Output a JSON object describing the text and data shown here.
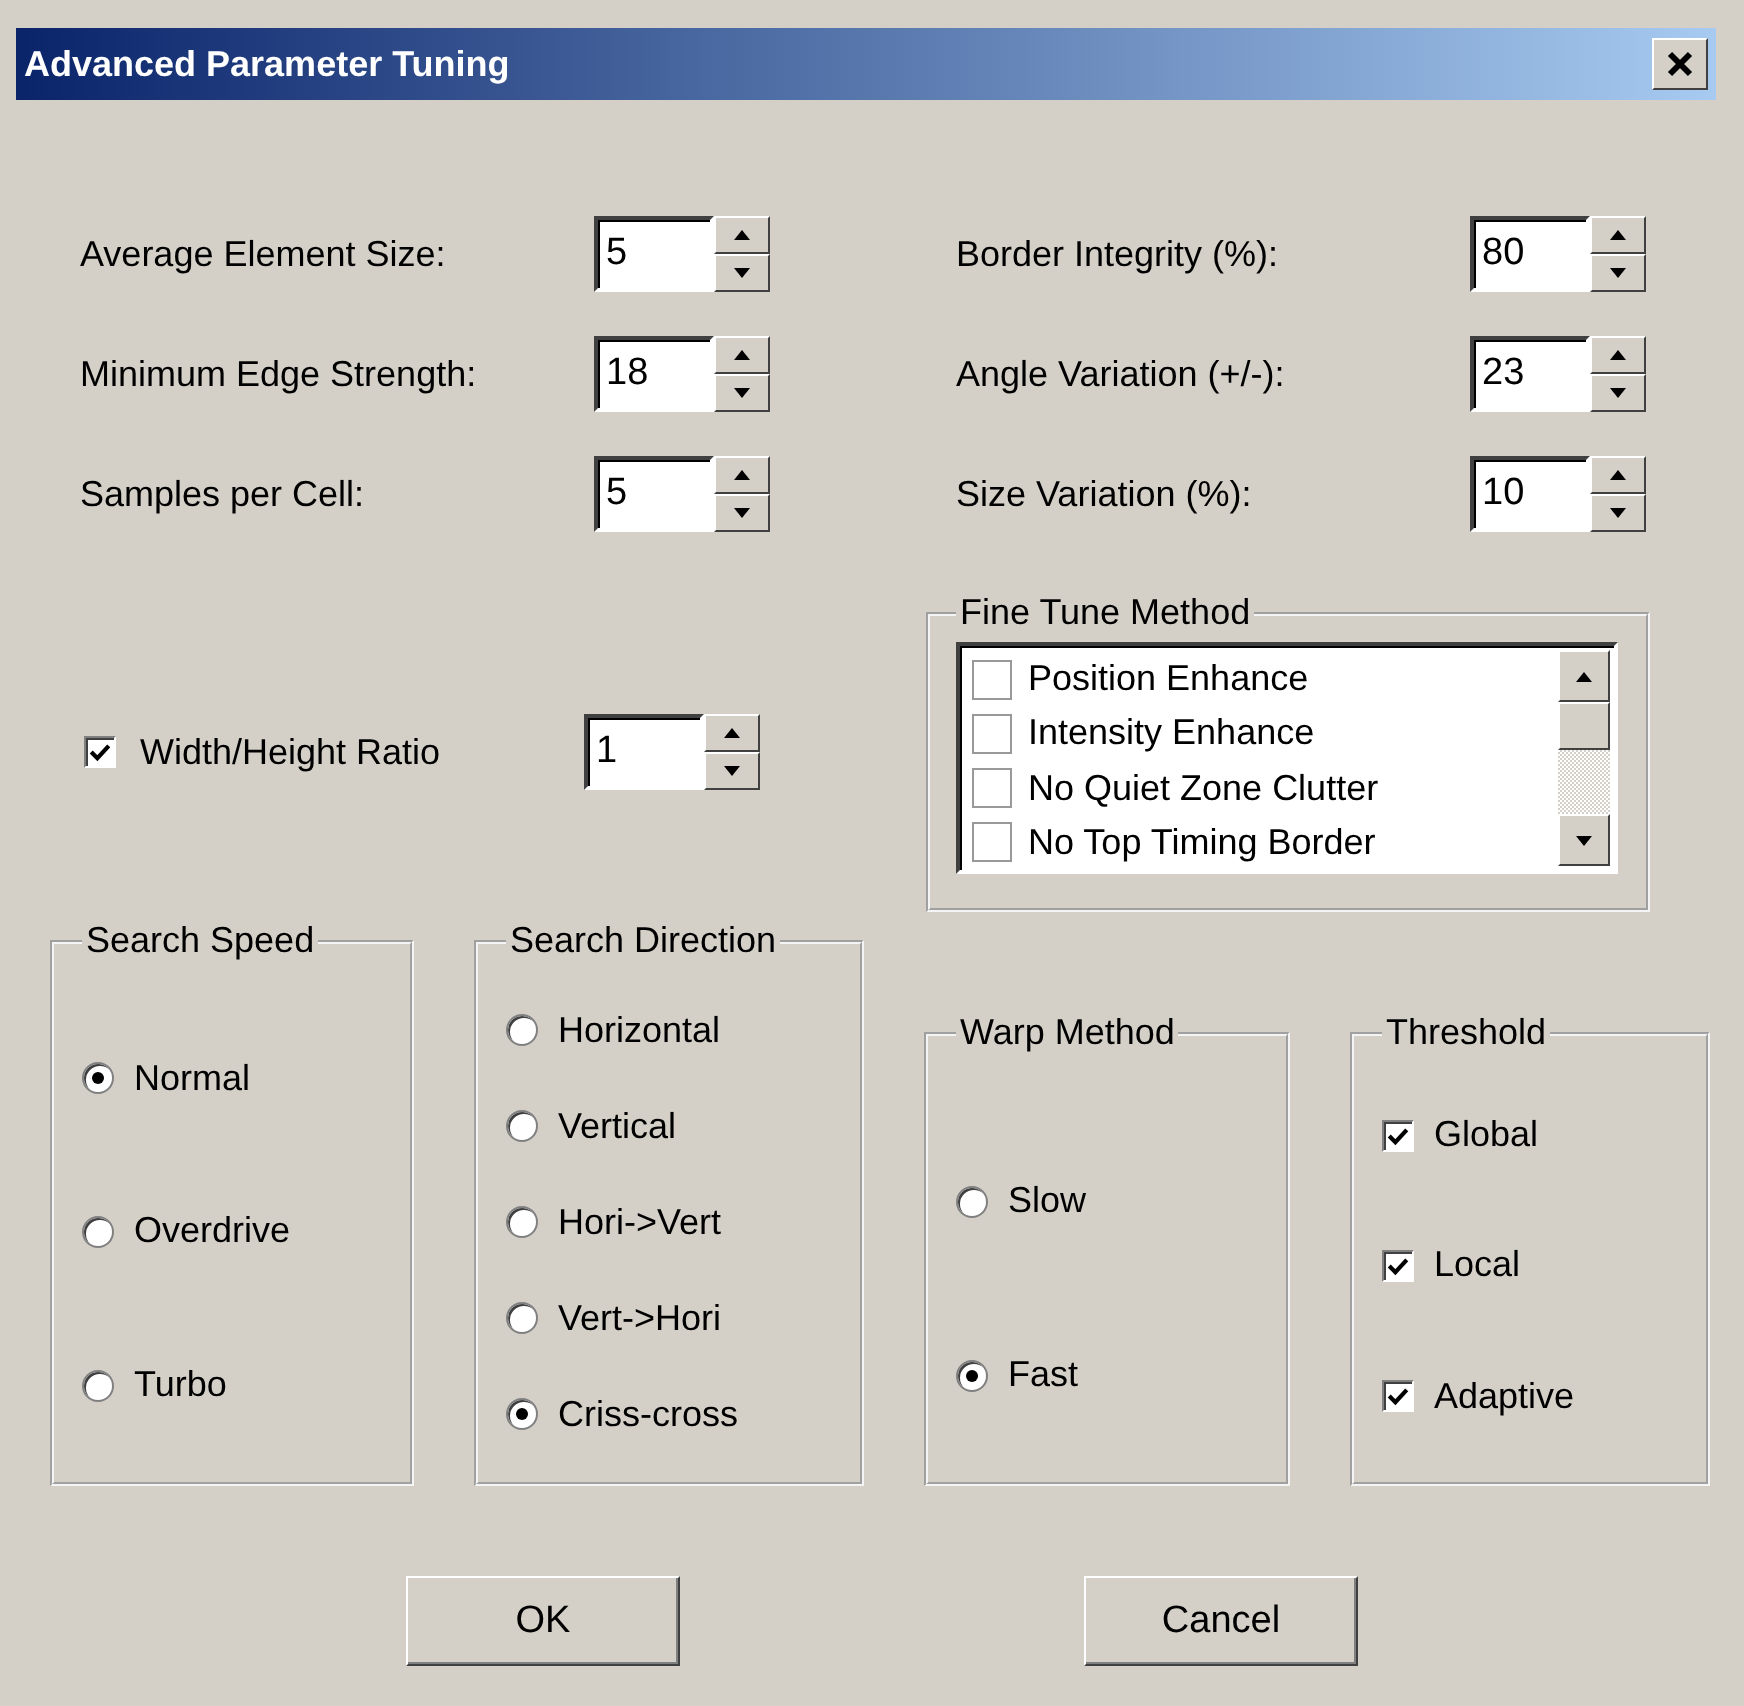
{
  "window": {
    "title": "Advanced Parameter Tuning"
  },
  "left_params": [
    {
      "label": "Average Element Size:",
      "value": "5"
    },
    {
      "label": "Minimum Edge Strength:",
      "value": "18"
    },
    {
      "label": "Samples per Cell:",
      "value": "5"
    }
  ],
  "right_params": [
    {
      "label": "Border Integrity (%):",
      "value": "80"
    },
    {
      "label": "Angle Variation (+/-):",
      "value": "23"
    },
    {
      "label": "Size Variation (%):",
      "value": "10"
    }
  ],
  "ratio": {
    "label": "Width/Height Ratio",
    "checked": true,
    "value": "1"
  },
  "fine_tune": {
    "title": "Fine Tune Method",
    "items": [
      {
        "label": "Position Enhance",
        "checked": false
      },
      {
        "label": "Intensity Enhance",
        "checked": false
      },
      {
        "label": "No Quiet Zone Clutter",
        "checked": false
      },
      {
        "label": "No Top Timing Border",
        "checked": false
      }
    ]
  },
  "search_speed": {
    "title": "Search Speed",
    "options": [
      {
        "label": "Normal",
        "selected": true
      },
      {
        "label": "Overdrive",
        "selected": false
      },
      {
        "label": "Turbo",
        "selected": false
      }
    ]
  },
  "search_direction": {
    "title": "Search Direction",
    "options": [
      {
        "label": "Horizontal",
        "selected": false
      },
      {
        "label": "Vertical",
        "selected": false
      },
      {
        "label": "Hori->Vert",
        "selected": false
      },
      {
        "label": "Vert->Hori",
        "selected": false
      },
      {
        "label": "Criss-cross",
        "selected": true
      }
    ]
  },
  "warp_method": {
    "title": "Warp Method",
    "options": [
      {
        "label": "Slow",
        "selected": false
      },
      {
        "label": "Fast",
        "selected": true
      }
    ]
  },
  "threshold": {
    "title": "Threshold",
    "options": [
      {
        "label": "Global",
        "checked": true
      },
      {
        "label": "Local",
        "checked": true
      },
      {
        "label": "Adaptive",
        "checked": true
      }
    ]
  },
  "buttons": [
    "OK",
    "Cancel"
  ]
}
